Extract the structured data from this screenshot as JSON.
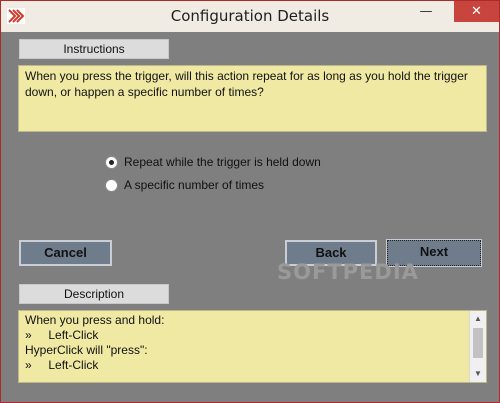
{
  "window": {
    "title": "Configuration Details",
    "minimize_glyph": "—",
    "maximize_glyph": "☐",
    "close_glyph": "✕"
  },
  "instructions": {
    "label": "Instructions",
    "text": "When you press the trigger, will this action repeat for as long as you hold the trigger down, or happen a specific number of times?"
  },
  "options": [
    {
      "label": "Repeat while the trigger is held down",
      "selected": true
    },
    {
      "label": "A specific number of times",
      "selected": false
    }
  ],
  "buttons": {
    "cancel": "Cancel",
    "back": "Back",
    "next": "Next"
  },
  "description": {
    "label": "Description",
    "lines": [
      "When you press and hold:",
      "»     Left-Click",
      "HyperClick will \"press\":",
      "»     Left-Click"
    ]
  },
  "scrollbar": {
    "up_glyph": "▲",
    "down_glyph": "▼"
  },
  "watermark": "SOFTPEDIA",
  "colors": {
    "accent_red": "#c0392b",
    "panel_yellow": "#f0e9a4",
    "button_slate": "#6f7c8c",
    "background_gray": "#7f7f7f"
  }
}
